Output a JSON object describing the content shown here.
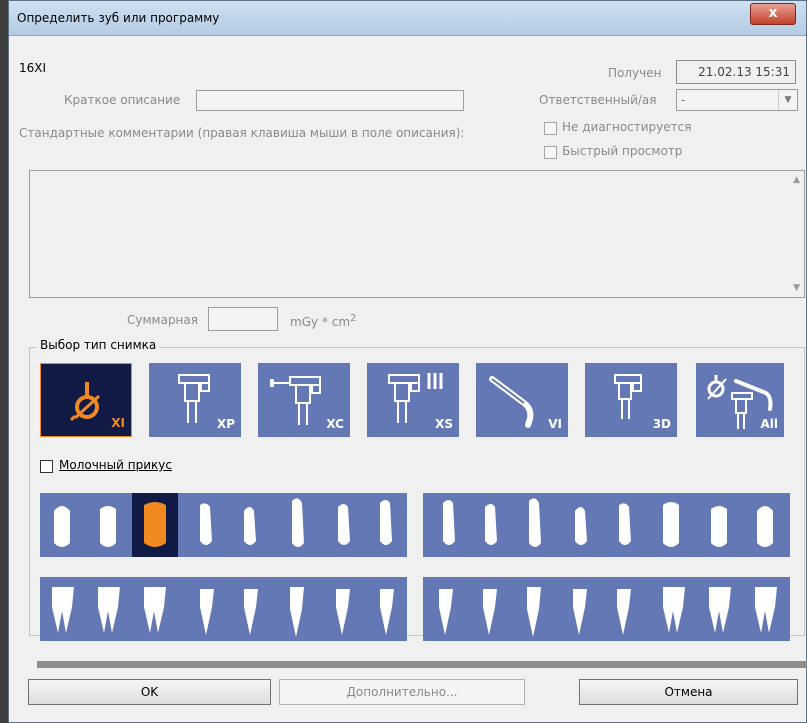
{
  "window": {
    "title": "Определить зуб или программу",
    "close": "x"
  },
  "header": {
    "code": "16XI",
    "received_label": "Получен",
    "received_value": "21.02.13 15:31",
    "short_desc_label": "Краткое описание",
    "short_desc_value": "",
    "responsible_label": "Ответственный/ая",
    "responsible_value": "-",
    "std_comments_label": "Стандартные комментарии (правая клавиша мыши в поле описания):",
    "not_diagnosed_label": "Не диагностируется",
    "quick_view_label": "Быстрый просмотр"
  },
  "dose": {
    "label": "Суммарная",
    "value": "",
    "unit": "mGy * cm",
    "unit_sup": "2"
  },
  "group": {
    "legend": "Выбор тип снимка",
    "milk_bite_label": "Молочный прикус"
  },
  "types": [
    {
      "code": "XI",
      "icon": "intraoral-sensor-icon",
      "selected": true
    },
    {
      "code": "XP",
      "icon": "panoramic-unit-icon",
      "selected": false
    },
    {
      "code": "XC",
      "icon": "cephalometric-unit-icon",
      "selected": false
    },
    {
      "code": "XS",
      "icon": "scanner-unit-icon",
      "selected": false
    },
    {
      "code": "VI",
      "icon": "intraoral-camera-icon",
      "selected": false
    },
    {
      "code": "3D",
      "icon": "cbct-unit-icon",
      "selected": false
    },
    {
      "code": "All",
      "icon": "all-devices-icon",
      "selected": false
    }
  ],
  "teeth": {
    "selected_upper_index": 2
  },
  "buttons": {
    "ok": "OK",
    "more": "Дополнительно...",
    "cancel": "Отмена"
  },
  "colors": {
    "button_bg": "#6478b6",
    "selected_bg": "#101a45",
    "accent": "#f08a20"
  }
}
